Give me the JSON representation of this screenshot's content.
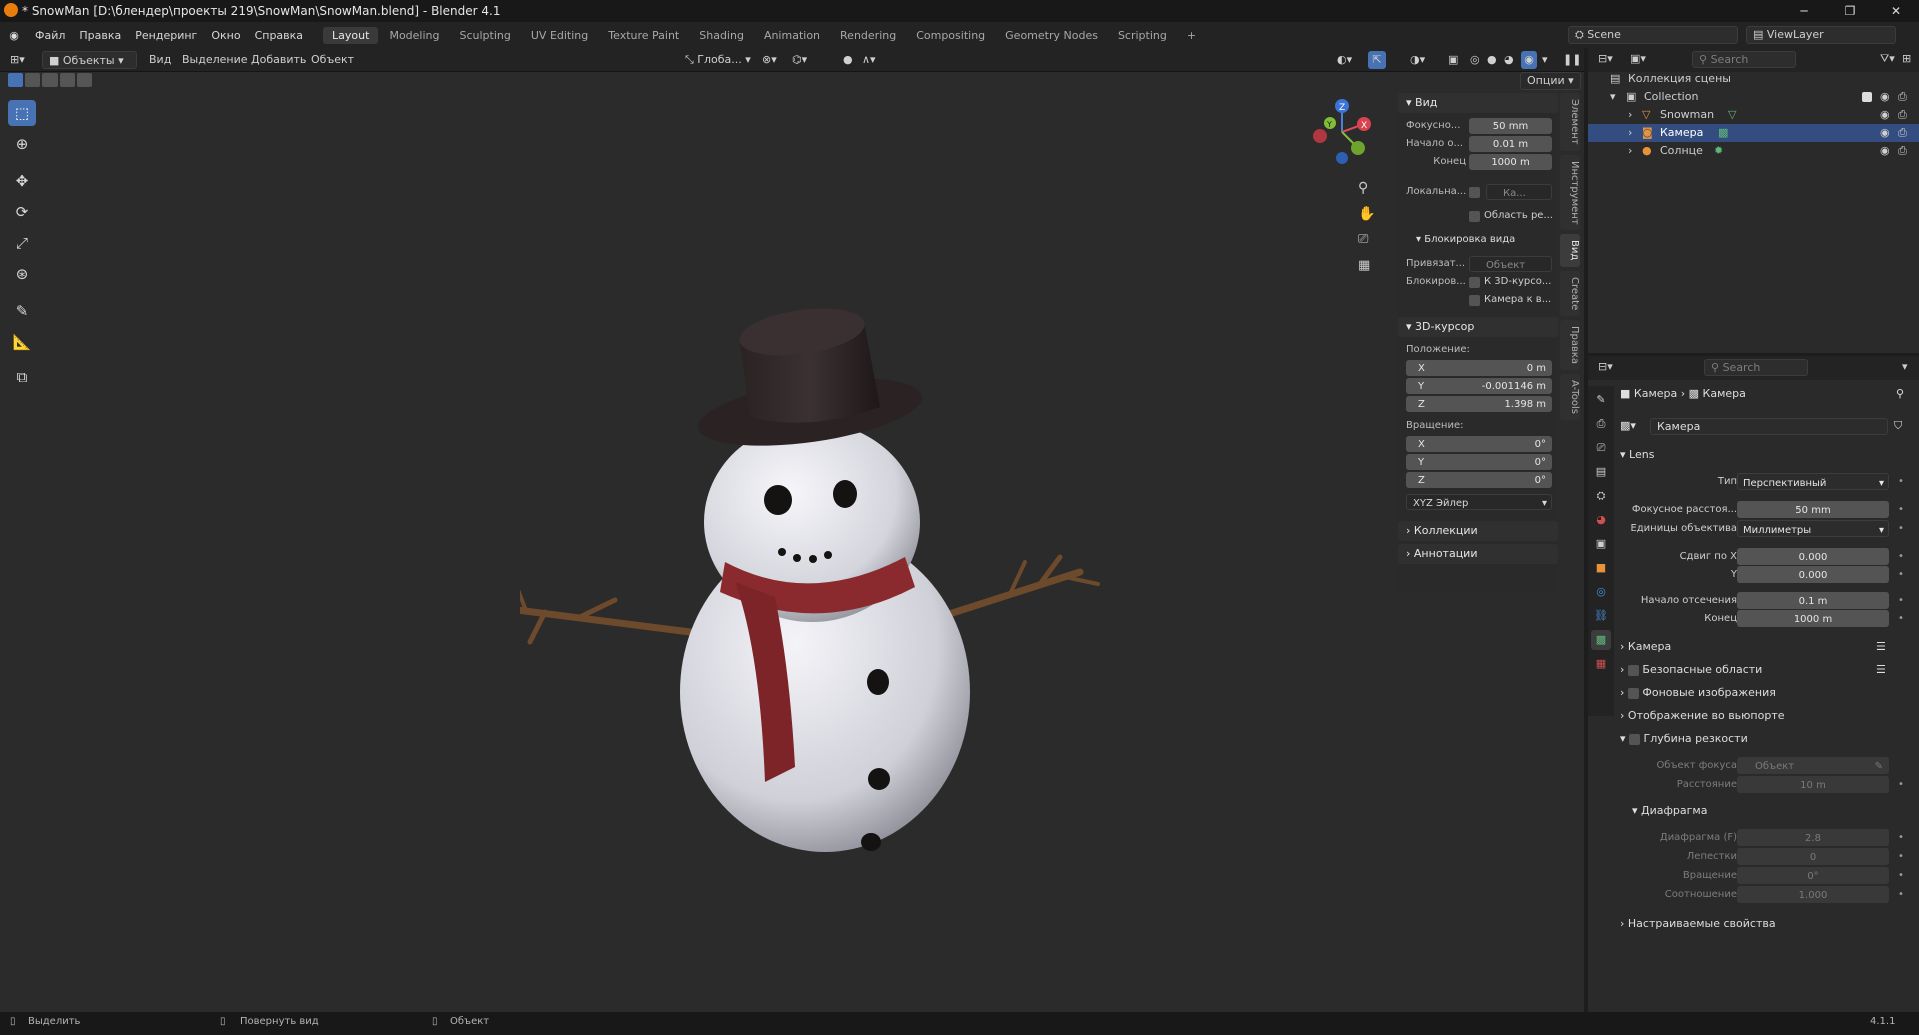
{
  "window": {
    "title": "* SnowMan [D:\\блендер\\проекты 219\\SnowMan\\SnowMan.blend] - Blender 4.1"
  },
  "menu": [
    "Файл",
    "Правка",
    "Рендеринг",
    "Окно",
    "Справка"
  ],
  "workspaces": [
    "Layout",
    "Modeling",
    "Sculpting",
    "UV Editing",
    "Texture Paint",
    "Shading",
    "Animation",
    "Rendering",
    "Compositing",
    "Geometry Nodes",
    "Scripting"
  ],
  "workspace_add": "+",
  "topright": {
    "scene": "Scene",
    "viewlayer": "ViewLayer"
  },
  "vp_header": {
    "mode": "Объекты",
    "view": "Вид",
    "select": "Выделение",
    "add": "Добавить",
    "object": "Объект",
    "orient": "Глоба...",
    "options": "Опции"
  },
  "npanel": {
    "view_title": "Вид",
    "focal_label": "Фокусно...",
    "focal": "50 mm",
    "clip_start_label": "Начало о...",
    "clip_start": "0.01 m",
    "clip_end_label": "Конец",
    "clip_end": "1000 m",
    "local_label": "Локальна...",
    "local_value": "Ка...",
    "region_label": "Область ре...",
    "lock_title": "Блокировка вида",
    "lock_to_label": "Привязат...",
    "lock_to_value": "Объект",
    "lock_label": "Блокиров...",
    "lock_cursor": "К 3D-курсо...",
    "lock_camera": "Камера к в...",
    "cursor_title": "3D-курсор",
    "location_label": "Положение:",
    "loc_x": "0 m",
    "loc_y": "-0.001146 m",
    "loc_z": "1.398 m",
    "rotation_label": "Вращение:",
    "rot_x": "0°",
    "rot_y": "0°",
    "rot_z": "0°",
    "rot_mode": "XYZ Эйлер",
    "collections": "Коллекции",
    "annotations": "Аннотации",
    "axis_x": "X",
    "axis_y": "Y",
    "axis_z": "Z"
  },
  "side_tabs": [
    "Элемент",
    "Инструмент",
    "Вид",
    "Create",
    "Правка",
    "A-Tools"
  ],
  "outliner": {
    "search_placeholder": "Search",
    "scene_collection": "Коллекция сцены",
    "items": [
      "Collection",
      "Snowman",
      "Камера",
      "Солнце"
    ]
  },
  "properties": {
    "search_placeholder": "Search",
    "breadcrumb_1": "Камера",
    "breadcrumb_2": "Камера",
    "datablock": "Камера",
    "lens_title": "Lens",
    "type_label": "Тип",
    "type_value": "Перспективный",
    "focal_label": "Фокусное расстоя...",
    "focal_value": "50 mm",
    "units_label": "Единицы объектива",
    "units_value": "Миллиметры",
    "shift_x_label": "Сдвиг по X",
    "shift_x": "0.000",
    "shift_y_label": "Y",
    "shift_y": "0.000",
    "clip_start_label": "Начало отсечения",
    "clip_start": "0.1 m",
    "clip_end_label": "Конец",
    "clip_end": "1000 m",
    "camera_section": "Камера",
    "safe_areas": "Безопасные области",
    "bg_images": "Фоновые изображения",
    "vp_display": "Отображение во вьюпорте",
    "dof": "Глубина резкости",
    "focus_obj_label": "Объект фокуса",
    "focus_obj_placeholder": "Объект",
    "distance_label": "Расстояние",
    "distance": "10 m",
    "aperture_title": "Диафрагма",
    "fstop_label": "Диафрагма (F)",
    "fstop": "2.8",
    "blades_label": "Лепестки",
    "blades": "0",
    "rotation_label": "Вращение",
    "rotation": "0°",
    "ratio_label": "Соотношение",
    "ratio": "1.000",
    "custom_props": "Настраиваемые свойства"
  },
  "status": {
    "select": "Выделить",
    "rotate": "Повернуть вид",
    "object": "Объект",
    "version": "4.1.1"
  },
  "colors": {
    "accent": "#4772b3",
    "selection": "#334d80",
    "snow": "#e8e8ec",
    "hat": "#2d2526",
    "scarf": "#8a2a2e",
    "branch": "#7a5232"
  }
}
